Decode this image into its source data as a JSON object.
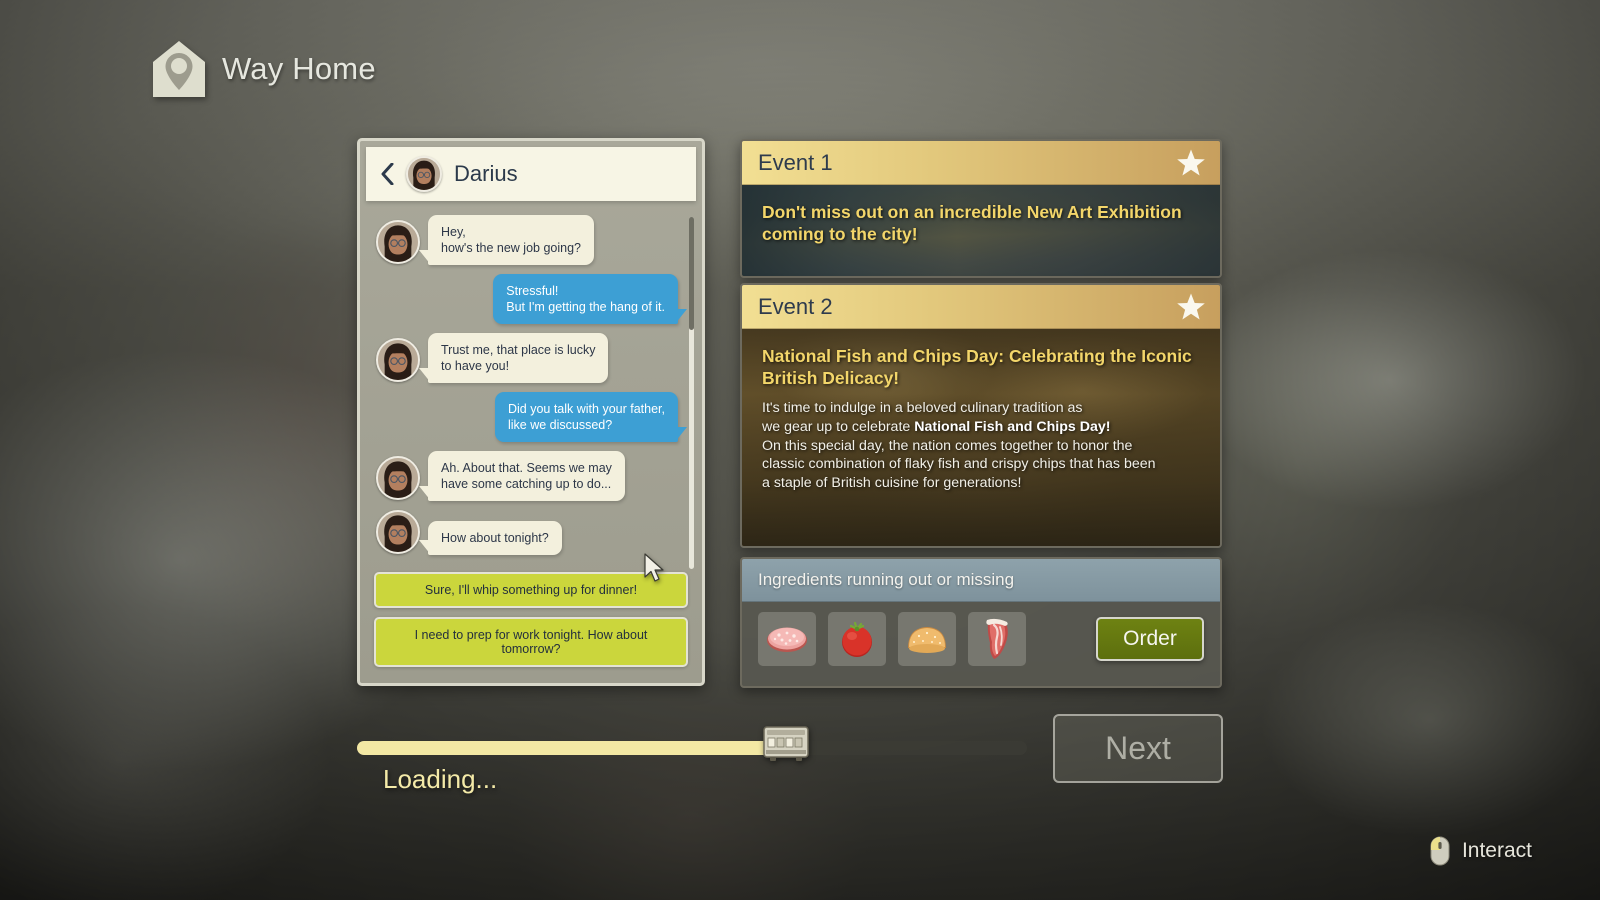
{
  "app": {
    "logo_icon": "house-pin-icon",
    "title": "Way Home"
  },
  "chat": {
    "back_icon": "back-chevron-icon",
    "contact_name": "Darius",
    "contact_avatar": "darius-avatar",
    "messages": [
      {
        "from": "them",
        "text": "Hey,\nhow's the new job going?",
        "avatar": "darius-avatar"
      },
      {
        "from": "me",
        "text": "Stressful!\nBut I'm getting the hang of it."
      },
      {
        "from": "them",
        "text": "Trust me, that place is lucky\nto have you!",
        "avatar": "darius-avatar"
      },
      {
        "from": "me",
        "text": "Did you talk with your father,\nlike we discussed?"
      },
      {
        "from": "them",
        "text": "Ah. About that. Seems we may\nhave some catching up to do...",
        "avatar": "darius-avatar"
      },
      {
        "from": "them",
        "text": "How about tonight?",
        "avatar": "darius-avatar"
      }
    ],
    "replies": [
      "Sure, I'll whip something up for dinner!",
      "I need to prep for work tonight. How about tomorrow?"
    ]
  },
  "events": [
    {
      "header": "Event 1",
      "star_icon": "star-icon",
      "lead": "Don't miss out on an incredible New Art Exhibition coming to the city!",
      "body": ""
    },
    {
      "header": "Event 2",
      "star_icon": "star-icon",
      "lead": "National Fish and Chips Day: Celebrating the Iconic British Delicacy!",
      "body_pre": "It's time to indulge in a beloved culinary tradition as\nwe gear up to celebrate ",
      "body_bold": "National Fish and Chips Day!",
      "body_post": "\nOn this special day, the nation comes together to honor the\nclassic combination of flaky fish and crispy chips that has been\na staple of British cuisine for generations!"
    }
  ],
  "ingredients": {
    "title": "Ingredients running out or missing",
    "items": [
      {
        "name": "salami-slice-icon"
      },
      {
        "name": "tomato-icon"
      },
      {
        "name": "burger-bun-icon"
      },
      {
        "name": "meat-cut-icon"
      }
    ],
    "order_label": "Order"
  },
  "progress": {
    "percent": 64,
    "marker_icon": "train-icon",
    "loading_label": "Loading..."
  },
  "next_button": {
    "label": "Next",
    "enabled": false
  },
  "interact_hint": {
    "icon": "mouse-left-click-icon",
    "label": "Interact"
  },
  "colors": {
    "accent_yellow": "#f3d66a",
    "reply_green": "#cbd63c",
    "order_green": "#6e8212",
    "bubble_me": "#3d9fd4",
    "bubble_them": "#f3f0dd",
    "event_header": "#e2c87c",
    "progress_fill": "#f3e8a4",
    "ingredients_header": "#8ea2ab"
  }
}
